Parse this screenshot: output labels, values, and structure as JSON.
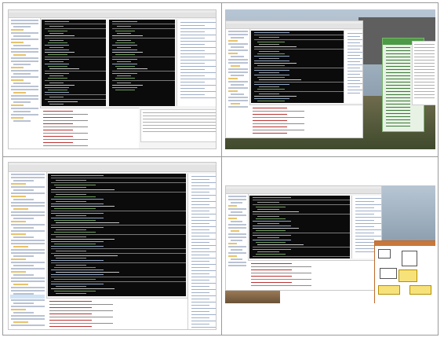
{
  "figure": {
    "panels": [
      {
        "id": "top-left",
        "content": "ide-two-dark-editors",
        "alt": ""
      },
      {
        "id": "top-right",
        "content": "ide-with-green-panel-over-landscape",
        "alt": ""
      },
      {
        "id": "bottom-left",
        "content": "ide-single-large-editor",
        "alt": ""
      },
      {
        "id": "bottom-right",
        "content": "ide-with-uml-diagram",
        "alt": ""
      }
    ]
  },
  "colors": {
    "editor_background": "#0b0b0b",
    "ide_chrome": "#f4f4f4",
    "panel_green": "#4c9a45",
    "uml_orange": "#c9783a",
    "uml_yellow": "#f7e27a",
    "grid_border": "#9a9a9a"
  }
}
